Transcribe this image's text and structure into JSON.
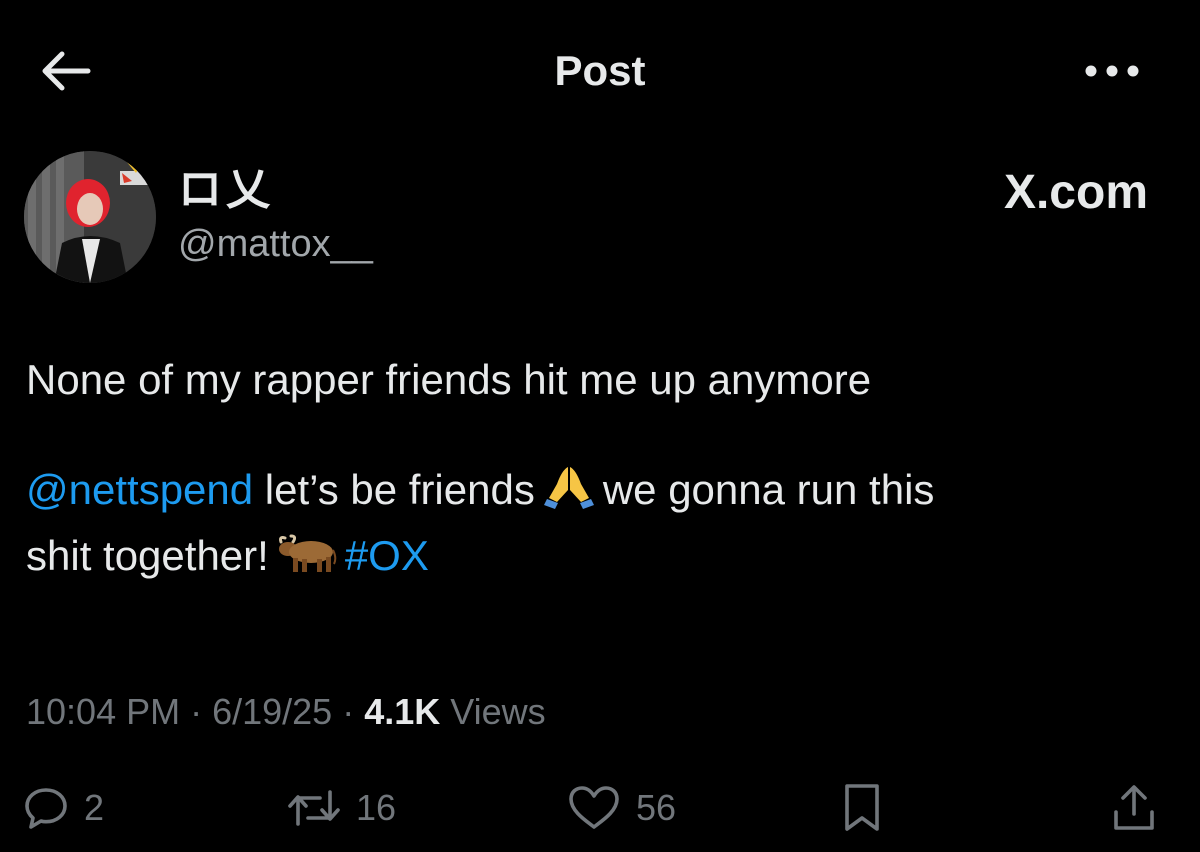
{
  "header": {
    "title": "Post",
    "back_icon": "arrow-left-icon",
    "more_icon": "more-horizontal-icon"
  },
  "author": {
    "display_name": "ロ乂",
    "handle": "@mattox__",
    "avatar_icon": "user-avatar"
  },
  "source_label": "X.com",
  "post": {
    "line1": "None of my rapper friends hit me up anymore",
    "mention": "@nettspend",
    "text_a": " let’s be friends",
    "emoji_a": "folded-hands-emoji",
    "text_b": "we gonna run this",
    "text_c": "shit together!",
    "emoji_b": "ox-emoji",
    "hashtag": "#OX"
  },
  "meta": {
    "time": "10:04 PM",
    "sep1": " · ",
    "date": "6/19/25",
    "sep2": " · ",
    "views_count": "4.1K",
    "views_label": " Views"
  },
  "actions": {
    "reply_count": "2",
    "repost_count": "16",
    "like_count": "56"
  },
  "colors": {
    "background": "#000000",
    "text": "#e7e9ea",
    "secondary": "#71767b",
    "link": "#1d9bf0"
  }
}
